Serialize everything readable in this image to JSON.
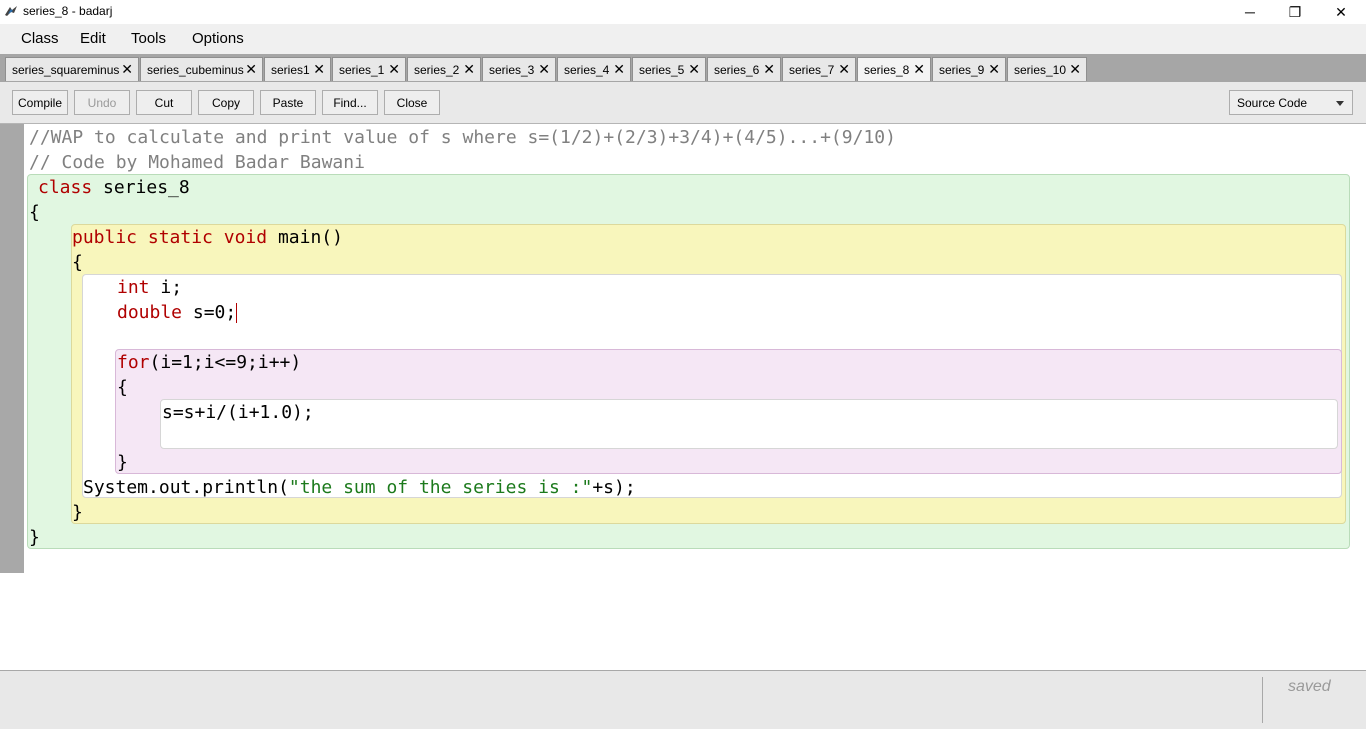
{
  "window": {
    "title": "series_8 - badarj",
    "minimize": "─",
    "maximize": "❐",
    "close": "✕"
  },
  "menu": [
    "Class",
    "Edit",
    "Tools",
    "Options"
  ],
  "tabs": [
    {
      "label": "series_squareminus"
    },
    {
      "label": "series_cubeminus"
    },
    {
      "label": "series1"
    },
    {
      "label": "series_1"
    },
    {
      "label": "series_2"
    },
    {
      "label": "series_3"
    },
    {
      "label": "series_4"
    },
    {
      "label": "series_5"
    },
    {
      "label": "series_6"
    },
    {
      "label": "series_7"
    },
    {
      "label": "series_8",
      "active": true
    },
    {
      "label": "series_9"
    },
    {
      "label": "series_10"
    }
  ],
  "tab_close_glyph": "✕",
  "toolbar": {
    "compile": "Compile",
    "undo": "Undo",
    "cut": "Cut",
    "copy": "Copy",
    "paste": "Paste",
    "find": "Find...",
    "close": "Close",
    "view_select": "Source Code"
  },
  "code": {
    "line1": "//WAP to calculate and print value of s where s=(1/2)+(2/3)+3/4)+(4/5)...+(9/10)",
    "line2": "// Code by Mohamed Badar Bawani",
    "kw_class": "class",
    "class_name": " series_8",
    "open_brace1": "{",
    "kw_public": "public",
    "kw_static": "static",
    "kw_void": "void",
    "method_name": " main()",
    "open_brace2": "{",
    "kw_int": "int",
    "int_decl": " i;",
    "kw_double": "double",
    "double_decl": " s=0;",
    "kw_for": "for",
    "for_header": "(i=1;i<=9;i++)",
    "open_brace3": "{",
    "loop_body": "s=s+i/(i+1.0);",
    "close_brace3": "}",
    "println_pre": "System.out.println(",
    "println_str": "\"the sum of the series is :\"",
    "println_post": "+s);",
    "close_brace2": "}",
    "close_brace1": "}"
  },
  "status": "saved"
}
